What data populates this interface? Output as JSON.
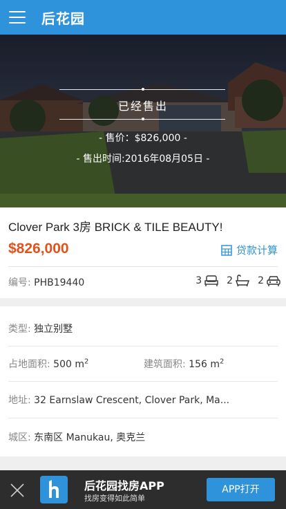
{
  "header": {
    "logo_text": "后花园",
    "menu_icon": "hamburger-menu-icon"
  },
  "hero": {
    "sold_status": "已经售出",
    "sale_price_text": "- 售价：$826,000 -",
    "sale_date_text": "- 售出时间:2016年08月05日 -"
  },
  "listing": {
    "title": "Clover Park 3房 BRICK & TILE BEAUTY!",
    "price": "$826,000",
    "loan_calc_label": "贷款计算",
    "ref_label": "编号:",
    "ref_value": "PHB19440",
    "bedrooms": "3",
    "bathrooms": "2",
    "garages": "2"
  },
  "details": {
    "type_label": "类型:",
    "type_value": "独立别墅",
    "land_label": "占地面积:",
    "land_value": "500 m",
    "land_unit_sup": "2",
    "floor_label": "建筑面积:",
    "floor_value": "156 m",
    "floor_unit_sup": "2",
    "address_label": "地址:",
    "address_value": "32 Earnslaw Crescent, Clover Park, Ma...",
    "region_label": "城区:",
    "region_value": "东南区 Manukau, 奥克兰"
  },
  "app_banner": {
    "app_name": "后花园找房APP",
    "slogan": "找房变得如此简单",
    "open_label": "APP打开"
  },
  "colors": {
    "brand_blue": "#2f93db",
    "price_orange": "#e2521a"
  }
}
